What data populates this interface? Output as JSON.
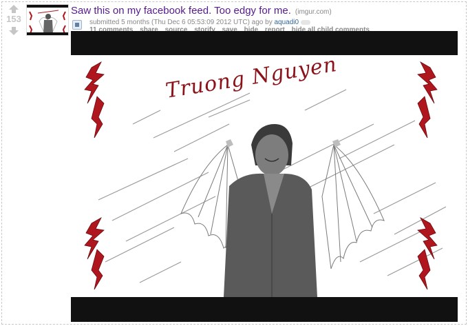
{
  "post": {
    "score": "153",
    "title": "Saw this on my facebook feed. Too edgy for me.",
    "domain": "(imgur.com)",
    "tagline": {
      "prefix": "submitted 5 months (Thu Dec 6 05:53:09 2012 UTC) ago by",
      "author": "aquadi0"
    },
    "buttons": [
      "11 comments",
      "share",
      "source",
      "storify",
      "save",
      "hide",
      "report",
      "hide all child comments"
    ]
  },
  "image": {
    "caption": "Truong Nguyen",
    "colors": {
      "accent_red": "#b0161e",
      "sketch_gray": "#6e6e6e",
      "band": "#111111"
    }
  },
  "icons": {
    "upvote": "up-arrow-icon",
    "downvote": "down-arrow-icon",
    "expando": "expando-image-icon"
  }
}
